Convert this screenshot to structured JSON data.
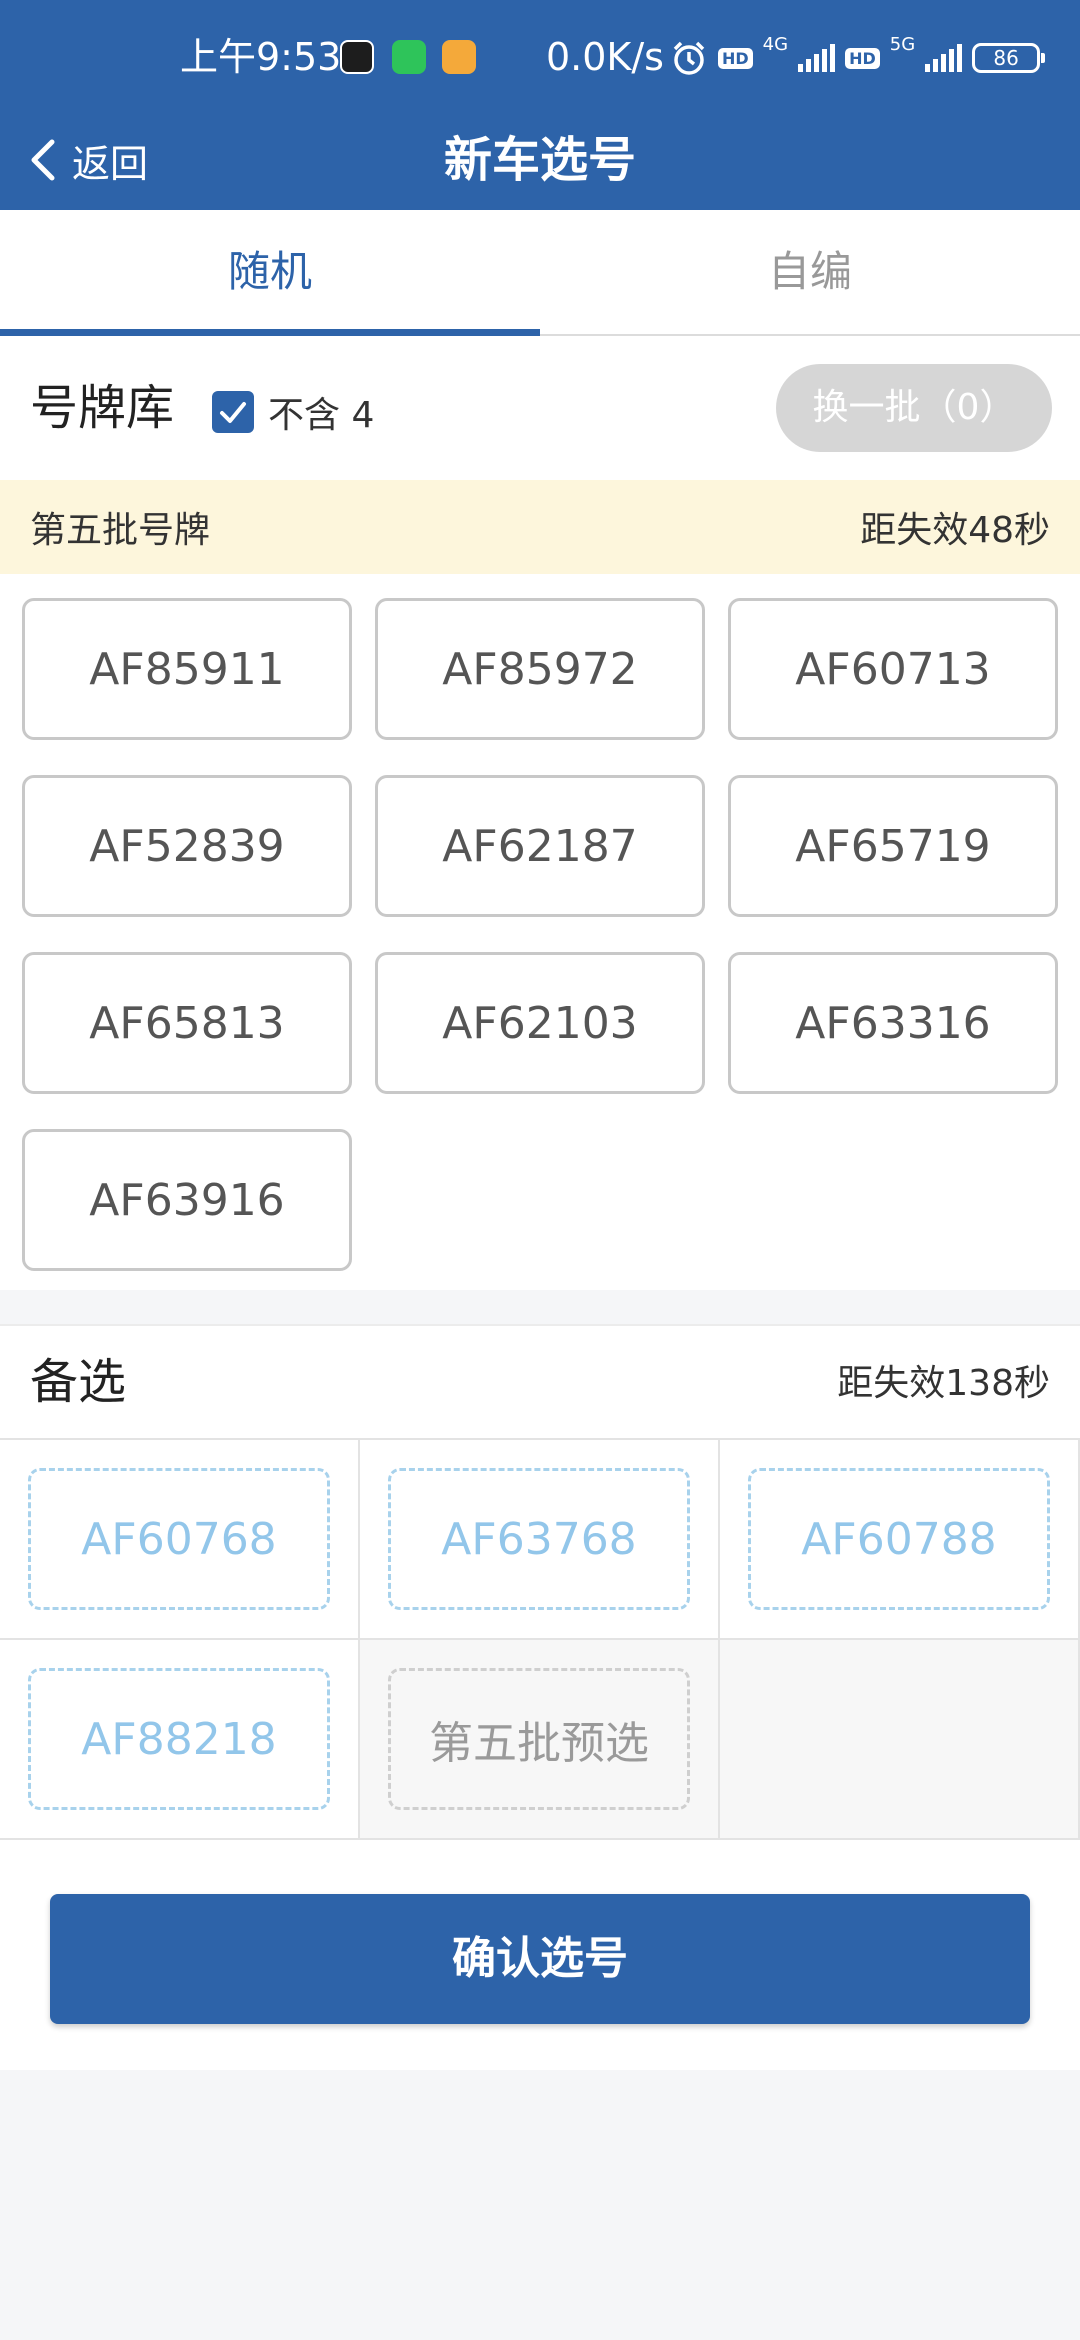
{
  "status_bar": {
    "time": "上午9:53",
    "net_rate": "0.0K/s",
    "hd_label": "HD",
    "sim1_label": "4G",
    "sim2_label": "5G",
    "battery": "86"
  },
  "app_bar": {
    "back_label": "返回",
    "title": "新车选号"
  },
  "tabs": [
    {
      "label": "随机",
      "active": true
    },
    {
      "label": "自编",
      "active": false
    }
  ],
  "plate_library": {
    "title": "号牌库",
    "exclude_label": "不含 4",
    "exclude_checked": true,
    "refresh_label": "换一批（0）",
    "batch_label": "第五批号牌",
    "expire_label": "距失效48秒",
    "plates": [
      "AF85911",
      "AF85972",
      "AF60713",
      "AF52839",
      "AF62187",
      "AF65719",
      "AF65813",
      "AF62103",
      "AF63316",
      "AF63916"
    ]
  },
  "alternates": {
    "title": "备选",
    "expire_label": "距失效138秒",
    "slots": [
      "AF60768",
      "AF63768",
      "AF60788",
      "AF88218"
    ],
    "preselect_label": "第五批预选"
  },
  "confirm_label": "确认选号",
  "colors": {
    "primary": "#2d63a9",
    "batch_bg": "#fdf6dc",
    "alt_text": "#92c6ea"
  }
}
